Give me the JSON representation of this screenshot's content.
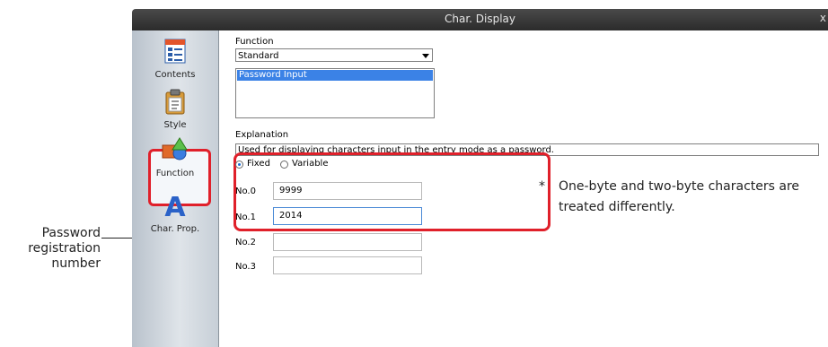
{
  "window": {
    "title": "Char. Display",
    "close_label": "x"
  },
  "sidebar": {
    "items": [
      {
        "label": "Contents",
        "icon": "contents-icon"
      },
      {
        "label": "Style",
        "icon": "style-icon"
      },
      {
        "label": "Function",
        "icon": "function-icon",
        "active": true
      },
      {
        "label": "Char. Prop.",
        "icon": "char-prop-icon"
      }
    ]
  },
  "function": {
    "label": "Function",
    "selected": "Standard",
    "list_items": [
      "Password Input"
    ]
  },
  "explanation": {
    "label": "Explanation",
    "value": "Used for displaying characters input in the entry mode as a password."
  },
  "password": {
    "mode_fixed": "Fixed",
    "mode_variable": "Variable",
    "mode_selected": "Fixed",
    "rows": [
      {
        "label": "No.0",
        "value": "9999"
      },
      {
        "label": "No.1",
        "value": "2014"
      },
      {
        "label": "No.2",
        "value": ""
      },
      {
        "label": "No.3",
        "value": ""
      }
    ]
  },
  "annotation": {
    "callout": "Password registration number",
    "note_star": "*",
    "note": "One-byte and two-byte characters are treated differently."
  },
  "colors": {
    "highlight": "#e0202a",
    "selection": "#3b82e6",
    "titlebar": "#333333"
  }
}
